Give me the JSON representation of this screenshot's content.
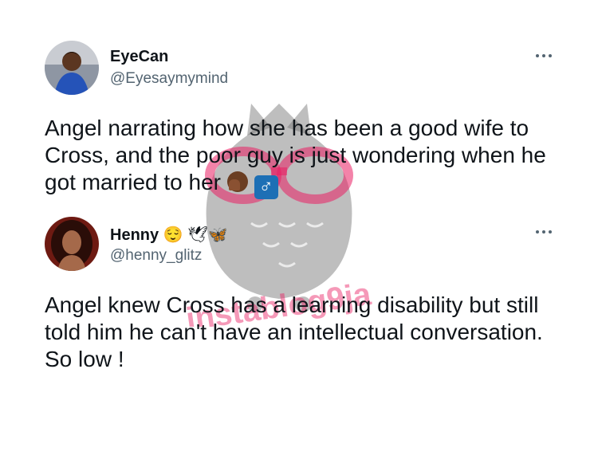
{
  "tweet1": {
    "name": "EyeCan",
    "handle": "@Eyesaymymind",
    "text": "Angel narrating how she has been a good wife to Cross, and the poor guy is just wondering when he got married to her",
    "emoji_trailing": "♂"
  },
  "tweet2": {
    "name": "Henny",
    "name_emojis": "😌 🕊🦋",
    "handle": "@henny_glitz",
    "text": "Angel knew Cross has a learning disability but still told him he can't have an intellectual conversation. So low !"
  },
  "watermark": {
    "text": "instablog9ja"
  },
  "icons": {
    "more_menu": "ellipsis-icon",
    "facepalm": "facepalm-emoji",
    "male_sign": "male-sign-emoji"
  },
  "colors": {
    "text": "#0f1419",
    "secondary": "#536471",
    "watermark_pink": "#e91e63",
    "watermark_gray": "#6f6f6f"
  }
}
